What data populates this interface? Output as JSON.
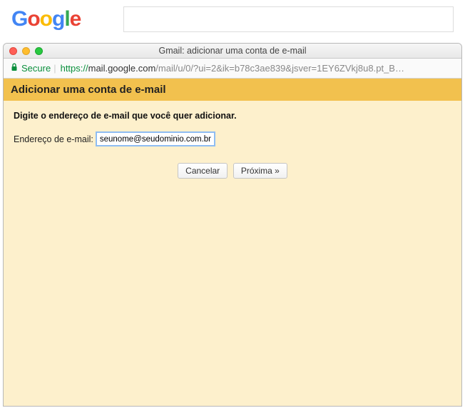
{
  "google_logo": {
    "g1": "G",
    "o1": "o",
    "o2": "o",
    "g2": "g",
    "l": "l",
    "e": "e"
  },
  "search": {
    "value": ""
  },
  "window": {
    "title": "Gmail: adicionar uma conta de e-mail"
  },
  "addressbar": {
    "secure_label": "Secure",
    "divider": "|",
    "scheme": "https://",
    "host": "mail.google.com",
    "path": "/mail/u/0/?ui=2&ik=b78c3ae839&jsver=1EY6ZVkj8u8.pt_B…"
  },
  "page": {
    "header": "Adicionar uma conta de e-mail",
    "instruction": "Digite o endereço de e-mail que você quer adicionar.",
    "email_label": "Endereço de e-mail:",
    "email_value": "seunome@seudominio.com.br",
    "cancel_label": "Cancelar",
    "next_label": "Próxima »"
  }
}
